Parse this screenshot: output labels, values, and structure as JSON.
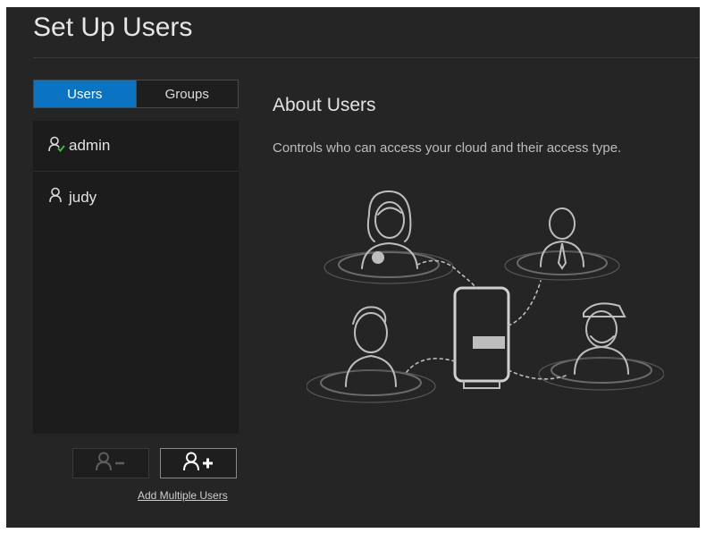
{
  "page": {
    "title": "Set Up Users"
  },
  "tabs": [
    {
      "label": "Users",
      "active": true
    },
    {
      "label": "Groups",
      "active": false
    }
  ],
  "users": [
    {
      "name": "admin",
      "icon": "user-admin-icon"
    },
    {
      "name": "judy",
      "icon": "user-icon"
    }
  ],
  "actions": {
    "remove_icon": "remove-user-icon",
    "add_icon": "add-user-icon",
    "add_multiple_label": "Add Multiple Users"
  },
  "about": {
    "title": "About Users",
    "description": "Controls who can access your cloud and their access type.",
    "illustration_icon": "users-cloud-illustration-icon"
  },
  "colors": {
    "accent": "#0a73c2",
    "background": "#252525",
    "list_background": "#1c1c1c",
    "admin_check": "#43b649"
  }
}
